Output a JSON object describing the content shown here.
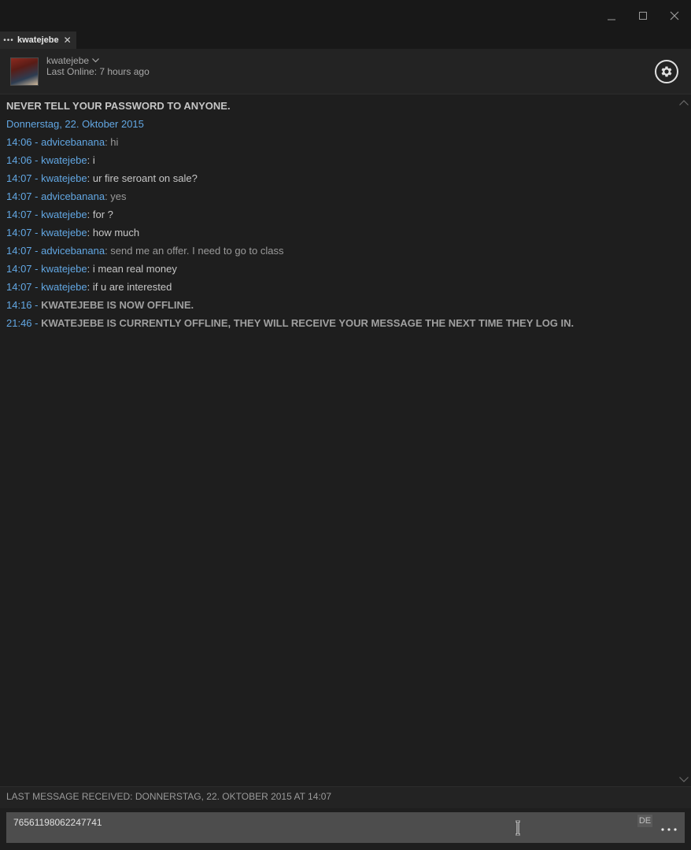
{
  "window": {
    "controls": [
      "minimize-icon",
      "maximize-icon",
      "close-icon"
    ]
  },
  "tab": {
    "menu_icon": "dots-icon",
    "label": "kwatejebe",
    "close_icon": "close-icon"
  },
  "header": {
    "username": "kwatejebe",
    "last_online": "Last Online: 7 hours ago",
    "settings_icon": "gear-icon"
  },
  "chat": {
    "warning": "NEVER TELL YOUR PASSWORD TO ANYONE.",
    "date": "Donnerstag, 22. Oktober 2015",
    "messages": [
      {
        "time": "14:06 - ",
        "name": "advicebanana",
        "sep": ": ",
        "text": "hi",
        "from": "me"
      },
      {
        "time": "14:06 - ",
        "name": "kwatejebe",
        "sep": ": ",
        "text": "i",
        "from": "them"
      },
      {
        "time": "14:07 - ",
        "name": "kwatejebe",
        "sep": ": ",
        "text": "ur fire seroant on sale?",
        "from": "them"
      },
      {
        "time": "14:07 - ",
        "name": "advicebanana",
        "sep": ": ",
        "text": "yes",
        "from": "me"
      },
      {
        "time": "14:07 - ",
        "name": "kwatejebe",
        "sep": ": ",
        "text": "for ?",
        "from": "them"
      },
      {
        "time": "14:07 - ",
        "name": "kwatejebe",
        "sep": ": ",
        "text": "how much",
        "from": "them"
      },
      {
        "time": "14:07 - ",
        "name": "advicebanana",
        "sep": ": ",
        "text": "send me an offer. I need to go to class",
        "from": "me"
      },
      {
        "time": "14:07 - ",
        "name": "kwatejebe",
        "sep": ": ",
        "text": "i mean real money",
        "from": "them"
      },
      {
        "time": "14:07 - ",
        "name": "kwatejebe",
        "sep": ": ",
        "text": "if u are interested",
        "from": "them"
      }
    ],
    "status_lines": [
      {
        "time": "14:16 - ",
        "text": "KWATEJEBE IS NOW OFFLINE."
      },
      {
        "time": "21:46 - ",
        "text": "KWATEJEBE IS CURRENTLY OFFLINE, THEY WILL RECEIVE YOUR MESSAGE THE NEXT TIME THEY LOG IN."
      }
    ]
  },
  "footer": {
    "last_received": "LAST MESSAGE RECEIVED: DONNERSTAG, 22. OKTOBER 2015 AT 14:07"
  },
  "input": {
    "value": "76561198062247741",
    "language": "DE",
    "more_icon": "more-options-icon"
  }
}
